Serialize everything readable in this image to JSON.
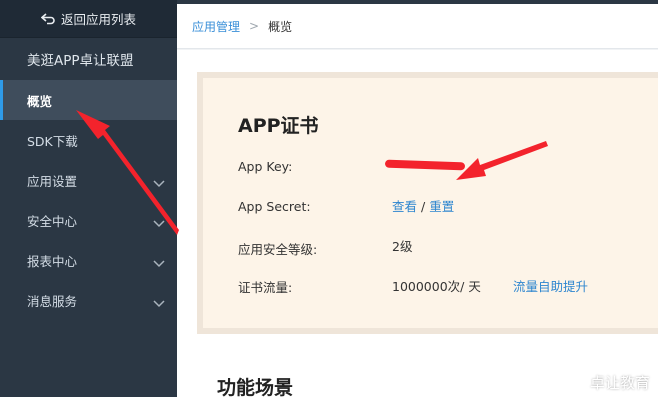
{
  "sidebar": {
    "back_label": "返回应用列表",
    "app_name": "美逛APP卓让联盟",
    "items": [
      {
        "label": "概览",
        "active": true,
        "has_chevron": false
      },
      {
        "label": "SDK下载",
        "active": false,
        "has_chevron": false
      },
      {
        "label": "应用设置",
        "active": false,
        "has_chevron": true
      },
      {
        "label": "安全中心",
        "active": false,
        "has_chevron": true
      },
      {
        "label": "报表中心",
        "active": false,
        "has_chevron": true
      },
      {
        "label": "消息服务",
        "active": false,
        "has_chevron": true
      }
    ]
  },
  "breadcrumb": {
    "parent": "应用管理",
    "separator": ">",
    "current": "概览"
  },
  "cert": {
    "title": "APP证书",
    "app_key_label": "App Key:",
    "app_secret_label": "App Secret:",
    "view_link": "查看",
    "slash": " / ",
    "reset_link": "重置",
    "security_label": "应用安全等级:",
    "security_value": "2级",
    "traffic_label": "证书流量:",
    "traffic_value": "1000000次/ 天",
    "traffic_link": "流量自助提升"
  },
  "section": {
    "title": "功能场景"
  },
  "watermark": "卓让教育",
  "colors": {
    "sidebar_bg": "#2b3744",
    "active_bg": "#3f4d5c",
    "link": "#2e86cf",
    "card_bg": "#fdf4e8",
    "annotation": "#f3232c"
  }
}
